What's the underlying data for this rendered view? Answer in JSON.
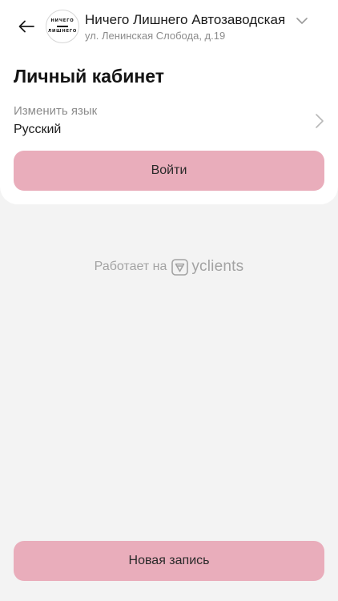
{
  "header": {
    "venue_name": "Ничего Лишнего Автозаводская",
    "venue_address": "ул. Ленинская Слобода, д.19",
    "logo_top": "НИЧЕГО",
    "logo_bottom": "ЛИШНЕГО"
  },
  "page": {
    "title": "Личный кабинет"
  },
  "language": {
    "label": "Изменить язык",
    "value": "Русский"
  },
  "buttons": {
    "login": "Войти",
    "new_booking": "Новая запись"
  },
  "footer": {
    "powered_text": "Работает на",
    "brand": "yclients"
  },
  "colors": {
    "accent": "#e9adbb",
    "background": "#f3f3f3",
    "card": "#ffffff",
    "muted_text": "#8c8c8c"
  },
  "icons": {
    "back": "arrow-left-icon",
    "venue_switch": "chevron-down-icon",
    "language_open": "chevron-right-icon",
    "brand": "yclients-logo-icon"
  }
}
